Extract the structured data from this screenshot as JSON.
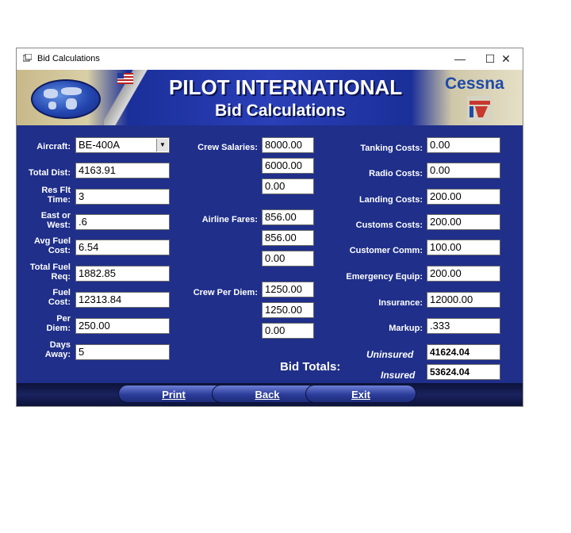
{
  "window": {
    "title": "Bid Calculations",
    "controls": {
      "minimize": "—",
      "maximize": "☐",
      "close": "✕"
    }
  },
  "banner": {
    "title": "PILOT INTERNATIONAL",
    "subtitle": "Bid Calculations",
    "brand": "Cessna"
  },
  "left": {
    "aircraft_label": "Aircraft:",
    "aircraft_value": "BE-400A",
    "total_dist_label": "Total Dist:",
    "total_dist": "4163.91",
    "res_flt_label_1": "Res Flt",
    "res_flt_label_2": "Time:",
    "res_flt": "3",
    "east_west_label_1": "East or",
    "east_west_label_2": "West:",
    "east_west": ".6",
    "avg_fuel_label_1": "Avg Fuel",
    "avg_fuel_label_2": "Cost:",
    "avg_fuel": "6.54",
    "total_fuel_label_1": "Total Fuel",
    "total_fuel_label_2": "Req:",
    "total_fuel": "1882.85",
    "fuel_cost_label_1": "Fuel",
    "fuel_cost_label_2": "Cost:",
    "fuel_cost": "12313.84",
    "per_diem_label_1": "Per",
    "per_diem_label_2": "Diem:",
    "per_diem": "250.00",
    "days_away_label_1": "Days",
    "days_away_label_2": "Away:",
    "days_away": "5"
  },
  "middle": {
    "crew_salaries_label": "Crew Salaries:",
    "crew_salaries": [
      "8000.00",
      "6000.00",
      "0.00"
    ],
    "airline_fares_label": "Airline Fares:",
    "airline_fares": [
      "856.00",
      "856.00",
      "0.00"
    ],
    "crew_per_diem_label": "Crew Per Diem:",
    "crew_per_diem": [
      "1250.00",
      "1250.00",
      "0.00"
    ],
    "bid_totals_label": "Bid Totals:"
  },
  "right": {
    "tanking_label": "Tanking Costs:",
    "tanking": "0.00",
    "radio_label": "Radio Costs:",
    "radio": "0.00",
    "landing_label": "Landing Costs:",
    "landing": "200.00",
    "customs_label": "Customs Costs:",
    "customs": "200.00",
    "customer_comm_label": "Customer Comm:",
    "customer_comm": "100.00",
    "emergency_label": "Emergency Equip:",
    "emergency": "200.00",
    "insurance_label": "Insurance:",
    "insurance": "12000.00",
    "markup_label": "Markup:",
    "markup": ".333",
    "uninsured_label": "Uninsured",
    "uninsured": "41624.04",
    "insured_label": "Insured",
    "insured": "53624.04"
  },
  "footer": {
    "print": "Print",
    "back": "Back",
    "exit": "Exit"
  },
  "colors": {
    "background": "#1f2f8a",
    "banner": "#2a3fb8",
    "brand_text": "#1f4aa8"
  }
}
